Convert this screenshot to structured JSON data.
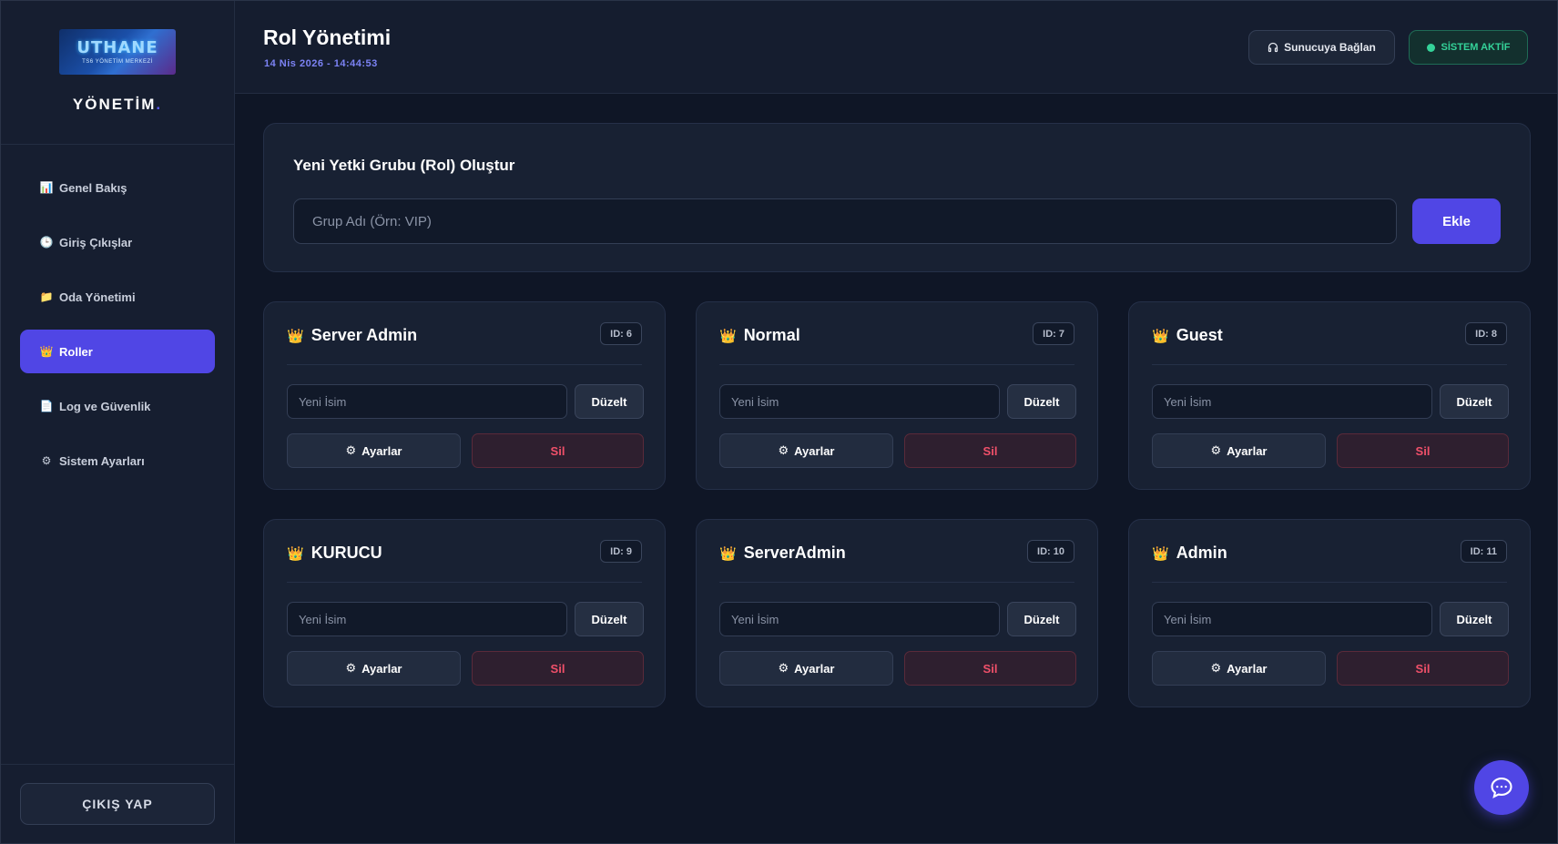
{
  "sidebar": {
    "logo_text": "UTHANE",
    "logo_subtitle": "TS6 YÖNETİM MERKEZİ",
    "brand_title": "YÖNETİM",
    "brand_dot": ".",
    "items": [
      {
        "label": "Genel Bakış",
        "icon": "chart-icon",
        "glyph": "📊",
        "active": false
      },
      {
        "label": "Giriş Çıkışlar",
        "icon": "clock-icon",
        "glyph": "🕒",
        "active": false
      },
      {
        "label": "Oda Yönetimi",
        "icon": "folder-icon",
        "glyph": "📁",
        "active": false
      },
      {
        "label": "Roller",
        "icon": "crown-icon",
        "glyph": "👑",
        "active": true
      },
      {
        "label": "Log ve Güvenlik",
        "icon": "document-icon",
        "glyph": "📄",
        "active": false
      },
      {
        "label": "Sistem Ayarları",
        "icon": "gear-icon",
        "glyph": "⚙",
        "active": false
      }
    ],
    "logout_label": "ÇIKIŞ YAP"
  },
  "header": {
    "title": "Rol Yönetimi",
    "datetime": "14 Nis 2026 - 14:44:53",
    "connect_label": "Sunucuya Bağlan",
    "connect_icon": "headphones-icon",
    "status_label": "SİSTEM AKTİF",
    "status_color": "#34d399"
  },
  "create": {
    "title": "Yeni Yetki Grubu (Rol) Oluştur",
    "placeholder": "Grup Adı (Örn: VIP)",
    "value": "",
    "add_label": "Ekle"
  },
  "roles": [
    {
      "name": "Server Admin",
      "id": "ID: 6",
      "rename_placeholder": "Yeni İsim",
      "edit_label": "Düzelt",
      "settings_label": "Ayarlar",
      "delete_label": "Sil"
    },
    {
      "name": "Normal",
      "id": "ID: 7",
      "rename_placeholder": "Yeni İsim",
      "edit_label": "Düzelt",
      "settings_label": "Ayarlar",
      "delete_label": "Sil"
    },
    {
      "name": "Guest",
      "id": "ID: 8",
      "rename_placeholder": "Yeni İsim",
      "edit_label": "Düzelt",
      "settings_label": "Ayarlar",
      "delete_label": "Sil"
    },
    {
      "name": "KURUCU",
      "id": "ID: 9",
      "rename_placeholder": "Yeni İsim",
      "edit_label": "Düzelt",
      "settings_label": "Ayarlar",
      "delete_label": "Sil"
    },
    {
      "name": "ServerAdmin",
      "id": "ID: 10",
      "rename_placeholder": "Yeni İsim",
      "edit_label": "Düzelt",
      "settings_label": "Ayarlar",
      "delete_label": "Sil"
    },
    {
      "name": "Admin",
      "id": "ID: 11",
      "rename_placeholder": "Yeni İsim",
      "edit_label": "Düzelt",
      "settings_label": "Ayarlar",
      "delete_label": "Sil"
    }
  ],
  "colors": {
    "accent": "#5046e5",
    "background": "#0f1626",
    "card": "#182133",
    "danger": "#f0506a",
    "date": "#7c83f5"
  },
  "chat_fab_icon": "chat-bubble-icon"
}
